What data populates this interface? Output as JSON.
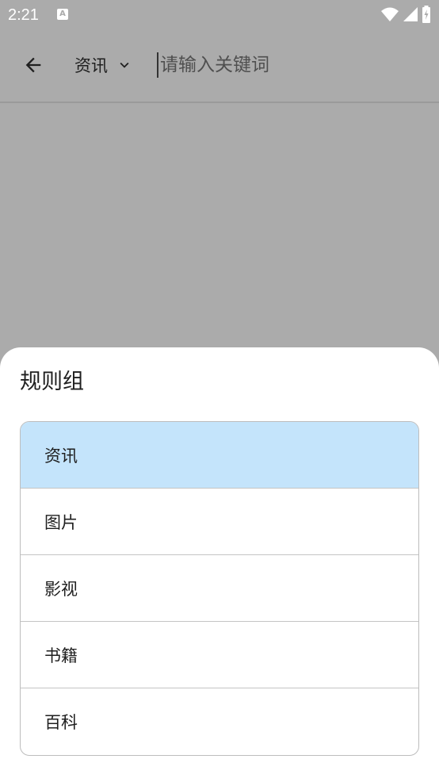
{
  "status_bar": {
    "time": "2:21",
    "notification_icon": "A",
    "icons": [
      "wifi-icon",
      "signal-icon",
      "battery-icon"
    ]
  },
  "app_bar": {
    "back_icon": "arrow-left-icon",
    "group_selector": {
      "selected_label": "资讯",
      "chevron_icon": "chevron-down-icon"
    },
    "search": {
      "value": "",
      "placeholder": "请输入关键词"
    }
  },
  "sheet": {
    "title": "规则组",
    "items": [
      {
        "label": "资讯",
        "selected": true
      },
      {
        "label": "图片",
        "selected": false
      },
      {
        "label": "影视",
        "selected": false
      },
      {
        "label": "书籍",
        "selected": false
      },
      {
        "label": "百科",
        "selected": false
      }
    ]
  },
  "colors": {
    "scrim": "#ababab",
    "selected_item_bg": "#c4e4fb",
    "sheet_bg": "#ffffff"
  }
}
